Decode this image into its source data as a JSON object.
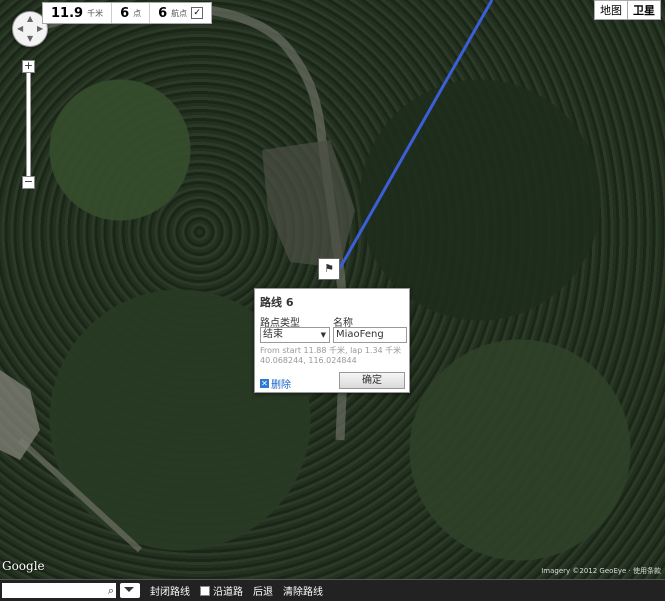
{
  "stats": {
    "distance_value": "11.9",
    "distance_unit": "千米",
    "points_value": "6",
    "points_unit": "点",
    "waypoints_value": "6",
    "waypoints_unit": "航点"
  },
  "map_type": {
    "map_label": "地图",
    "satellite_label": "卫星"
  },
  "zoom": {
    "in_label": "+",
    "out_label": "−"
  },
  "marker": {
    "glyph": "⚑"
  },
  "popup": {
    "title": "路线 6",
    "waypoint_type_label": "路点类型",
    "waypoint_type_value": "结束",
    "name_label": "名称",
    "name_value": "MiaoFeng",
    "info_line1": "From start 11.88 千米, lap 1.34 千米",
    "info_line2": "40.068244, 116.024844",
    "delete_label": "删除",
    "confirm_label": "确定"
  },
  "branding": {
    "google": "Google",
    "copyright": "Imagery ©2012 GeoEye · 使用条款"
  },
  "toolbar": {
    "search_value": "",
    "close_route": "封闭路线",
    "follow_road": "沿道路",
    "back": "后退",
    "clear_route": "清除路线"
  },
  "route_color": "#3c5fd8",
  "icons": {
    "pan": "pan-control-icon",
    "marker": "flag-icon",
    "search": "magnifier-icon",
    "delete": "x-icon"
  }
}
